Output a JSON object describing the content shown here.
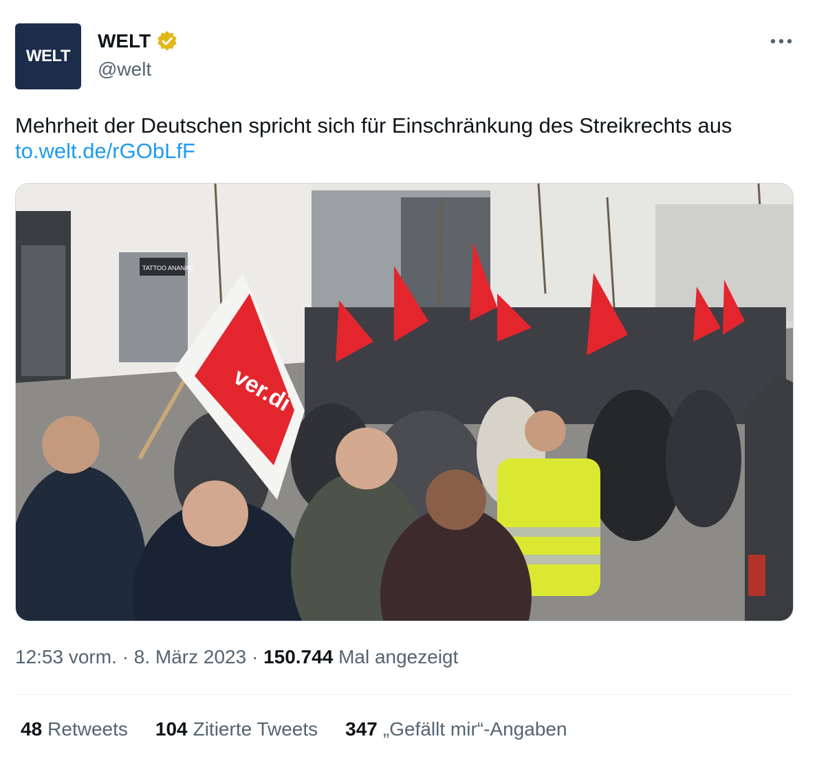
{
  "author": {
    "logo_text": "WELT",
    "display_name": "WELT",
    "handle": "@welt",
    "verified_icon": "gold-verified-badge",
    "brand_color": "#1b2d4a",
    "badge_color": "#e2b719"
  },
  "tweet": {
    "text": "Mehrheit der Deutschen spricht sich für Einschränkung des Streikrechts aus",
    "link": "to.welt.de/rGObLfF",
    "link_color": "#1d9bf0"
  },
  "image": {
    "flag_text": "ver.di",
    "shop_sign": "TATTOO ANANAS",
    "flag_color": "#e3262d"
  },
  "meta": {
    "time": "12:53 vorm.",
    "separator": "·",
    "date": "8. März 2023",
    "views_count": "150.744",
    "views_label": "Mal angezeigt"
  },
  "stats": {
    "retweets_count": "48",
    "retweets_label": "Retweets",
    "quotes_count": "104",
    "quotes_label": "Zitierte Tweets",
    "likes_count": "347",
    "likes_label": "„Gefällt mir“-Angaben"
  }
}
